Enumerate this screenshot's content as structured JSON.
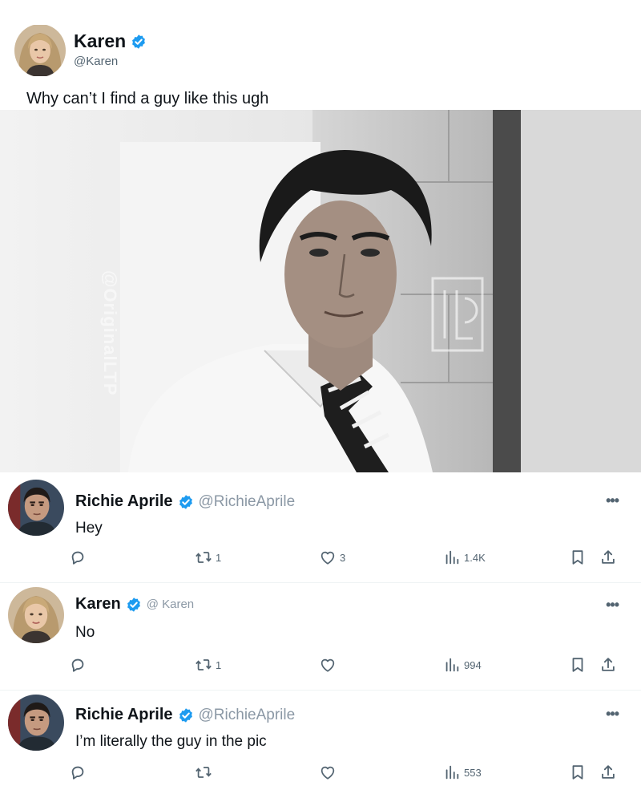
{
  "post": {
    "name": "Karen",
    "handle": "@Karen",
    "text": "Why can’t I find a guy like this ugh",
    "photo_watermark": "@OriginalLTP",
    "verified_color": "#1d9bf0"
  },
  "replies": [
    {
      "name": "Richie Aprile",
      "handle": "@RichieAprile",
      "text": "Hey",
      "retweets": "1",
      "likes": "3",
      "views": "1.4K"
    },
    {
      "name": "Karen",
      "handle": "@ Karen",
      "text": "No",
      "retweets": "1",
      "likes": "",
      "views": "994"
    },
    {
      "name": "Richie Aprile",
      "handle": "@RichieAprile",
      "text": "I’m literally the guy in the pic",
      "retweets": "",
      "likes": "",
      "views": "553"
    }
  ],
  "icons": {
    "reply": "reply-icon",
    "retweet": "retweet-icon",
    "like": "heart-icon",
    "views": "views-icon",
    "bookmark": "bookmark-icon",
    "share": "share-icon",
    "more": "more-icon",
    "verified": "verified-badge-icon"
  }
}
